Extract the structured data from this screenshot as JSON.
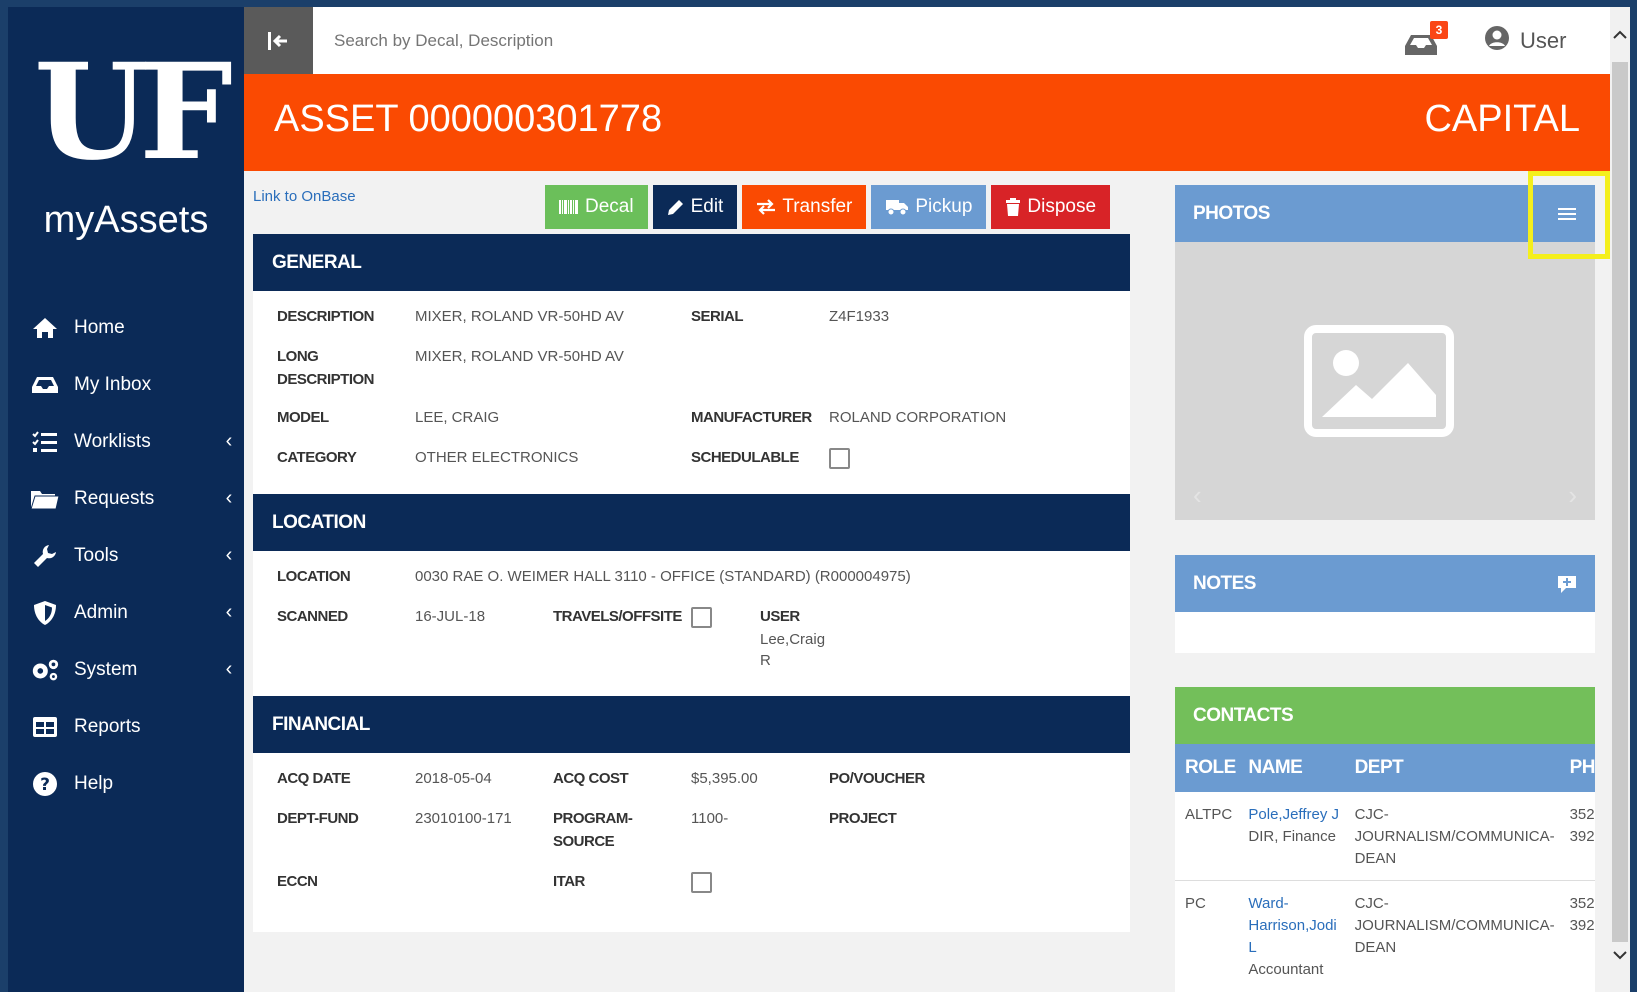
{
  "sidebar": {
    "logo": "UF",
    "app_name": "myAssets",
    "items": [
      {
        "label": "Home",
        "icon": "home-icon",
        "has_submenu": false
      },
      {
        "label": "My Inbox",
        "icon": "inbox-icon",
        "has_submenu": false
      },
      {
        "label": "Worklists",
        "icon": "list-icon",
        "has_submenu": true
      },
      {
        "label": "Requests",
        "icon": "folder-icon",
        "has_submenu": true
      },
      {
        "label": "Tools",
        "icon": "wrench-icon",
        "has_submenu": true
      },
      {
        "label": "Admin",
        "icon": "shield-icon",
        "has_submenu": true
      },
      {
        "label": "System",
        "icon": "gears-icon",
        "has_submenu": true
      },
      {
        "label": "Reports",
        "icon": "table-icon",
        "has_submenu": false
      },
      {
        "label": "Help",
        "icon": "help-icon",
        "has_submenu": false
      }
    ],
    "chevron": "‹"
  },
  "topbar": {
    "search_placeholder": "Search by Decal, Description",
    "inbox_count": "3",
    "user_label": "User"
  },
  "banner": {
    "title": "ASSET 000000301778",
    "type": "CAPITAL"
  },
  "actions": {
    "onbase_link": "Link to OnBase",
    "decal": "Decal",
    "edit": "Edit",
    "transfer": "Transfer",
    "pickup": "Pickup",
    "dispose": "Dispose"
  },
  "general": {
    "heading": "GENERAL",
    "description_label": "DESCRIPTION",
    "description": "MIXER, ROLAND VR-50HD AV",
    "serial_label": "SERIAL",
    "serial": "Z4F1933",
    "long_description_label_1": "LONG",
    "long_description_label_2": "DESCRIPTION",
    "long_description": "MIXER, ROLAND VR-50HD AV",
    "model_label": "MODEL",
    "model": "LEE, CRAIG",
    "manufacturer_label": "MANUFACTURER",
    "manufacturer": "ROLAND CORPORATION",
    "category_label": "CATEGORY",
    "category": "OTHER ELECTRONICS",
    "schedulable_label": "SCHEDULABLE",
    "schedulable": false
  },
  "location": {
    "heading": "LOCATION",
    "location_label": "LOCATION",
    "location": "0030 RAE O. WEIMER HALL 3110 - OFFICE (STANDARD) (R000004975)",
    "scanned_label": "SCANNED",
    "scanned": "16-JUL-18",
    "travels_label": "TRAVELS/OFFSITE",
    "travels": false,
    "user_label": "USER",
    "user_line1": "Lee,Craig",
    "user_line2": "R"
  },
  "financial": {
    "heading": "FINANCIAL",
    "acq_date_label": "ACQ DATE",
    "acq_date": "2018-05-04",
    "acq_cost_label": "ACQ COST",
    "acq_cost": "$5,395.00",
    "po_label": "PO/VOUCHER",
    "dept_fund_label": "DEPT-FUND",
    "dept_fund": "23010100-171",
    "program_label_1": "PROGRAM-",
    "program_label_2": "SOURCE",
    "program": "1100-",
    "project_label": "PROJECT",
    "eccn_label": "ECCN",
    "itar_label": "ITAR",
    "itar": false
  },
  "photos": {
    "heading": "PHOTOS"
  },
  "notes": {
    "heading": "NOTES"
  },
  "contacts": {
    "heading": "CONTACTS",
    "columns": [
      "ROLE",
      "NAME",
      "DEPT",
      "PH"
    ],
    "rows": [
      {
        "role": "ALTPC",
        "name": "Pole,Jeffrey J",
        "title": "DIR, Finance",
        "dept_1": "CJC-",
        "dept_2": "JOURNALISM/COMMUNICA-",
        "dept_3": "DEAN",
        "phone_1": "352",
        "phone_2": "392"
      },
      {
        "role": "PC",
        "name_1": "Ward-",
        "name_2": "Harrison,Jodi",
        "name_3": "L",
        "title": "Accountant",
        "dept_1": "CJC-",
        "dept_2": "JOURNALISM/COMMUNICA-",
        "dept_3": "DEAN",
        "phone_1": "352",
        "phone_2": "392"
      }
    ]
  },
  "colors": {
    "navy": "#0b2a57",
    "orange": "#fa4a02",
    "blue": "#6b9bd1",
    "green": "#73bf5a",
    "red": "#d82327",
    "highlight": "#f4ef1c"
  }
}
